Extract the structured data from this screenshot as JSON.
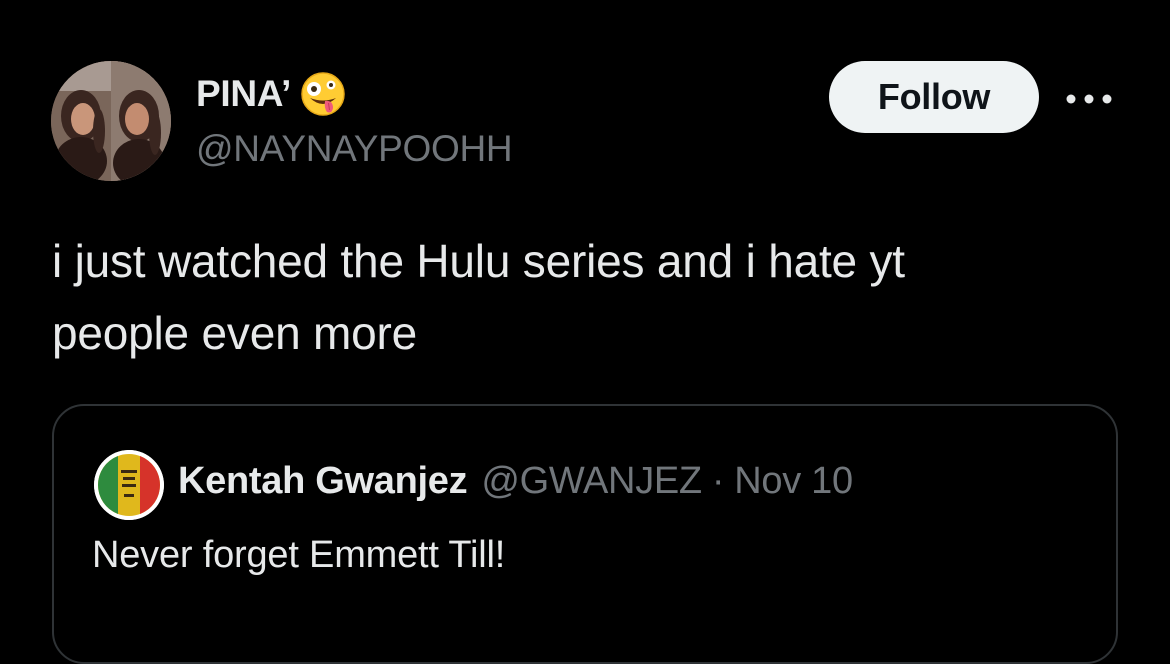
{
  "author": {
    "display_name": "PINA’",
    "display_name_emoji": "zany-face-emoji",
    "handle": "@NAYNAYPOOHH",
    "avatar_icon": "profile-photo-avatar"
  },
  "actions": {
    "follow_label": "Follow",
    "more_icon": "more-horizontal-icon"
  },
  "tweet": {
    "text_line_1": "i just watched the Hulu series and i hate yt",
    "text_line_2": "people even more"
  },
  "quoted_tweet": {
    "author_name": "Kentah Gwanjez",
    "author_handle": "@GWANJEZ",
    "separator": "·",
    "date": "Nov 10",
    "text": "Never forget Emmett Till!",
    "avatar_icon": "rasta-flag-avatar"
  },
  "colors": {
    "background": "#000000",
    "primary_text": "#e7e9ea",
    "secondary_text": "#71767b",
    "border": "#2f3336",
    "follow_button_bg": "#eff3f4",
    "follow_button_text": "#0f1419"
  }
}
